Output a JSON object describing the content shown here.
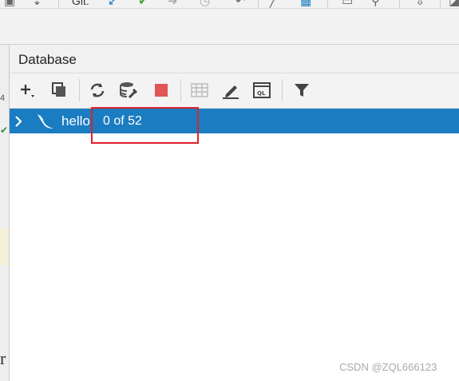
{
  "top_toolbar": {
    "vcs_label": "Git:"
  },
  "left_gutter": {
    "partial_char": "r",
    "partial_digit": "4"
  },
  "panel": {
    "title": "Database"
  },
  "toolbar": {
    "buttons": [
      "add-icon",
      "copy-icon",
      "refresh-icon",
      "properties-icon",
      "stop-icon",
      "table-icon",
      "edit-icon",
      "console-icon",
      "filter-icon"
    ],
    "colors": {
      "stop": "#e05555",
      "selection": "#1a7cc1",
      "highlight_box": "#e0202a"
    }
  },
  "tree": {
    "items": [
      {
        "label": "hello",
        "count": "0 of 52",
        "icon": "sqlite-icon",
        "expanded": false,
        "selected": true
      }
    ]
  },
  "watermark": "CSDN @ZQL666123"
}
